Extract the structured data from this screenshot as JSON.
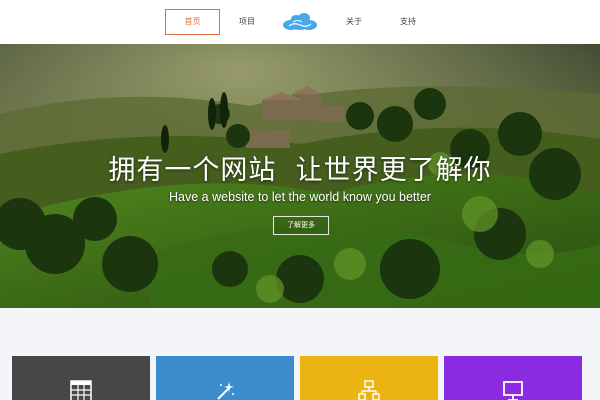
{
  "nav": {
    "home": "首页",
    "projects": "项目",
    "about": "关于",
    "support": "支持",
    "logo_icon": "cloud-icon",
    "active_color": "#e2703f"
  },
  "hero": {
    "title": "拥有一个网站  让世界更了解你",
    "subtitle": "Have a website to let the world know you better",
    "button": "了解更多"
  },
  "features": {
    "cards": [
      {
        "icon": "grid-icon",
        "color": "#474747"
      },
      {
        "icon": "magic-wand-icon",
        "color": "#3a8ccb"
      },
      {
        "icon": "sitemap-icon",
        "color": "#ecb413"
      },
      {
        "icon": "monitor-icon",
        "color": "#8a2be2"
      }
    ]
  }
}
